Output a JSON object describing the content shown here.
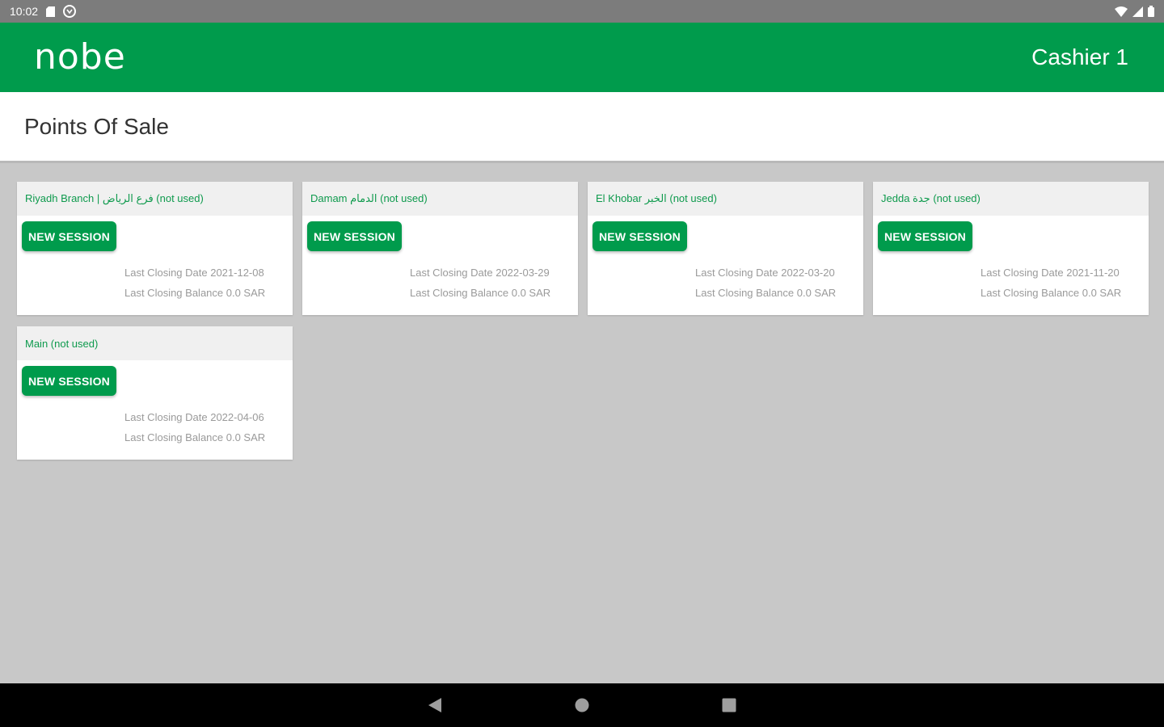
{
  "status_bar": {
    "time": "10:02"
  },
  "header": {
    "logo": "nobe",
    "cashier": "Cashier 1"
  },
  "page": {
    "title": "Points Of Sale"
  },
  "pos_cards": [
    {
      "name": "Riyadh Branch | فرع الرياض (not used)",
      "button": "NEW SESSION",
      "last_closing_date": "Last Closing Date 2021-12-08",
      "last_closing_balance": "Last Closing Balance 0.0 SAR"
    },
    {
      "name": "Damam الدمام (not used)",
      "button": "NEW SESSION",
      "last_closing_date": "Last Closing Date 2022-03-29",
      "last_closing_balance": "Last Closing Balance 0.0 SAR"
    },
    {
      "name": "El Khobar الخبر (not used)",
      "button": "NEW SESSION",
      "last_closing_date": "Last Closing Date 2022-03-20",
      "last_closing_balance": "Last Closing Balance 0.0 SAR"
    },
    {
      "name": "Jedda جدة (not used)",
      "button": "NEW SESSION",
      "last_closing_date": "Last Closing Date 2021-11-20",
      "last_closing_balance": "Last Closing Balance 0.0 SAR"
    },
    {
      "name": "Main (not used)",
      "button": "NEW SESSION",
      "last_closing_date": "Last Closing Date 2022-04-06",
      "last_closing_balance": "Last Closing Balance 0.0 SAR"
    }
  ],
  "colors": {
    "brand_green": "#009b4c",
    "background": "#c8c8c8"
  },
  "icons": {
    "status_left": [
      "sd-card-icon",
      "sync-icon"
    ],
    "status_right": [
      "wifi-icon",
      "signal-icon",
      "battery-icon"
    ],
    "nav": [
      "back-icon",
      "home-icon",
      "recents-icon"
    ]
  }
}
